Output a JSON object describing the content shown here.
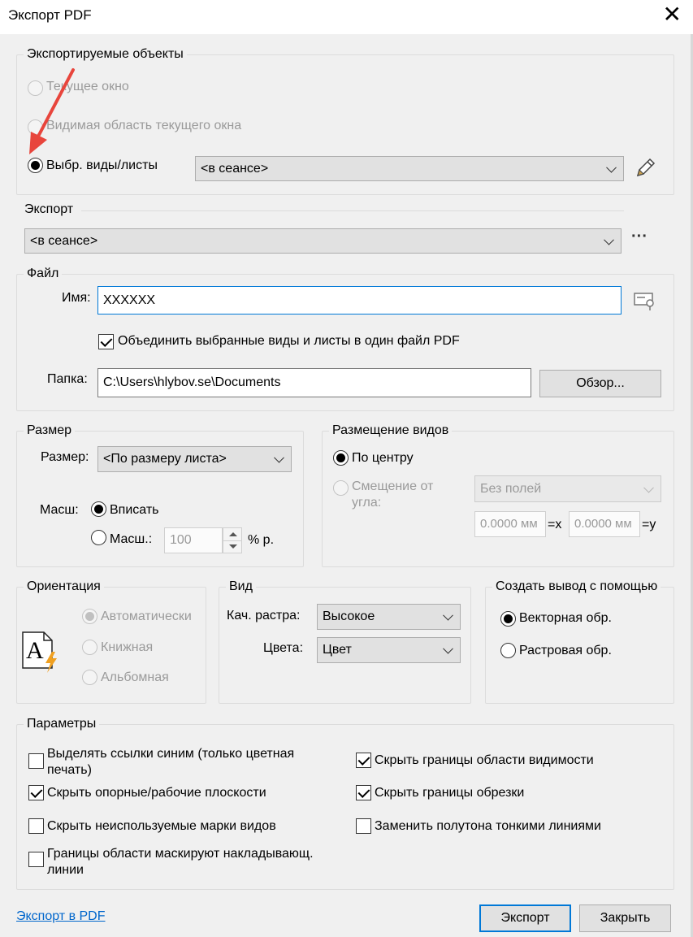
{
  "window": {
    "title": "Экспорт PDF",
    "close_symbol": "✕"
  },
  "objects_group": {
    "legend": "Экспортируемые объекты",
    "radio_current_window": "Текущее окно",
    "radio_visible_area": "Видимая область текущего окна",
    "radio_selected_views": "Выбр. виды/листы",
    "selection_value": "<в сеансе>"
  },
  "export_group": {
    "legend": "Экспорт",
    "setup_value": "<в сеансе>",
    "more_symbol": "···"
  },
  "file_group": {
    "legend": "Файл",
    "name_label": "Имя:",
    "name_value": "XXXXXX",
    "combine_label": "Объединить выбранные виды и листы в один файл PDF",
    "combine_checked": true,
    "folder_label": "Папка:",
    "folder_value": "C:\\Users\\hlybov.se\\Documents",
    "browse_label": "Обзор..."
  },
  "size_group": {
    "legend": "Размер",
    "size_label": "Размер:",
    "size_value": "<По размеру листа>",
    "scale_label": "Масш:",
    "fit_label": "Вписать",
    "zoom_label": "Масш.:",
    "zoom_value": "100",
    "percent_label": "% р."
  },
  "placement_group": {
    "legend": "Размещение видов",
    "center_label": "По центру",
    "offset_label_1": "Смещение от",
    "offset_label_2": "угла:",
    "margin_value": "Без полей",
    "x_value": "0.0000 мм",
    "x_suffix": "=x",
    "y_value": "0.0000 мм",
    "y_suffix": "=y"
  },
  "orientation_group": {
    "legend": "Ориентация",
    "auto_label": "Автоматически",
    "portrait_label": "Книжная",
    "landscape_label": "Альбомная",
    "icon_letter": "A"
  },
  "view_group": {
    "legend": "Вид",
    "raster_label": "Кач. растра:",
    "raster_value": "Высокое",
    "colors_label": "Цвета:",
    "colors_value": "Цвет"
  },
  "output_group": {
    "legend": "Создать вывод с помощью",
    "vector_label": "Векторная обр.",
    "raster_label": "Растровая обр."
  },
  "params_group": {
    "legend": "Параметры",
    "blue_links_1": "Выделять ссылки синим (только цветная",
    "blue_links_2": "печать)",
    "hide_ref_planes": "Скрыть опорные/рабочие плоскости",
    "hide_unused_tags": "Скрыть неиспользуемые марки видов",
    "mask_lines_1": "Границы области маскируют накладывающ.",
    "mask_lines_2": "линии",
    "hide_scope_boxes": "Скрыть границы области видимости",
    "hide_crop_boundaries": "Скрыть границы обрезки",
    "replace_halftone": "Заменить полутона тонкими линиями"
  },
  "footer": {
    "help_link": "Экспорт в PDF",
    "export_button": "Экспорт",
    "close_button": "Закрыть"
  },
  "colors": {
    "accent": "#0078d7",
    "arrow": "#e8453c",
    "link": "#0066cc",
    "lightning": "#f0a020"
  }
}
